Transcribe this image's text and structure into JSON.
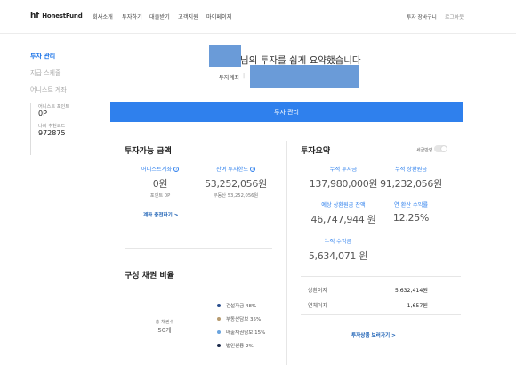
{
  "header": {
    "logo_text": "HonestFund",
    "logo_mark": "hf",
    "nav": [
      "회사소개",
      "투자하기",
      "대출받기",
      "고객지원",
      "마이페이지"
    ],
    "cart": "투자 장바구니",
    "logout": "로그아웃"
  },
  "sidebar": {
    "items": [
      "투자 관리",
      "지급 스케줄",
      "어니스트 계좌"
    ],
    "point_label": "어니스트 포인트",
    "point_value": "0P",
    "referral_label": "나의 추천코드",
    "referral_value": "972875"
  },
  "welcome": {
    "text": "님의 투자를 쉽게 요약했습니다",
    "account_label": "투자계좌",
    "account_sep": "|"
  },
  "main_button": "투자 관리",
  "available": {
    "title": "투자가능 금액",
    "honest_label": "어니스트계좌",
    "honest_value": "0원",
    "point_label": "포인트 0P",
    "remain_label": "잔여 투자한도",
    "remain_value": "53,252,056원",
    "remain_sub": "부동산 53,252,056원",
    "charge_link": "계좌 충전하기 >"
  },
  "summary": {
    "title": "투자요약",
    "toggle_label": "세금반영",
    "total_invest_label": "누적 투자금",
    "total_invest_value": "137,980,000원",
    "total_repaid_label": "누적 상환원금",
    "total_repaid_value": "91,232,056원",
    "expected_label": "예상 상환원금 잔액",
    "expected_value": "46,747,944 원",
    "yield_label": "연 환산 수익률",
    "yield_value": "12.25%",
    "profit_label": "누적 수익금",
    "profit_value": "5,634,071 원",
    "interest_label": "상환이자",
    "interest_value": "5,632,414원",
    "delay_label": "연체이자",
    "delay_value": "1,657원",
    "product_link": "투자상품 보러가기 >"
  },
  "composition": {
    "title": "구성 채권 비율",
    "count_label": "총 채권수",
    "count_value": "50개",
    "legend": [
      {
        "label": "건설자금  48%",
        "color": "#2a4f8f"
      },
      {
        "label": "부동산담보  35%",
        "color": "#b79b70"
      },
      {
        "label": "매출채권담보  15%",
        "color": "#6aa4de"
      },
      {
        "label": "법인신용  2%",
        "color": "#1c2a4a"
      }
    ]
  }
}
